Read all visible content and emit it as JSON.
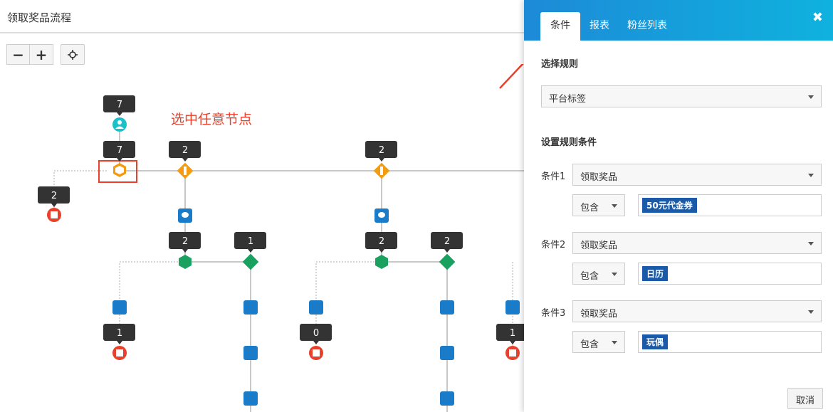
{
  "page": {
    "title": "领取奖品流程"
  },
  "zoom": {
    "out_label": "−",
    "in_label": "+",
    "center_icon": "crosshair-icon"
  },
  "annotation": {
    "text": "选中任意节点"
  },
  "flow": {
    "counts": {
      "top_user": "7",
      "selected": "7",
      "branch_a": "2",
      "branch_b": "2",
      "end_left": "2",
      "hex_a": "2",
      "diamond_a": "1",
      "hex_b": "2",
      "diamond_b": "2",
      "end_a": "1",
      "end_b": "0",
      "end_c": "1"
    }
  },
  "panel": {
    "tabs": [
      "条件",
      "报表",
      "粉丝列表"
    ],
    "active_tab": "条件",
    "close_icon": "close-icon",
    "rule_section_title": "选择规则",
    "rule_select": "平台标签",
    "cond_section_title": "设置规则条件",
    "conditions": [
      {
        "label": "条件1",
        "field": "领取奖品",
        "operator": "包含",
        "tag": "50元代金券"
      },
      {
        "label": "条件2",
        "field": "领取奖品",
        "operator": "包含",
        "tag": "日历"
      },
      {
        "label": "条件3",
        "field": "领取奖品",
        "operator": "包含",
        "tag": "玩偶"
      }
    ],
    "cancel_label": "取消"
  },
  "colors": {
    "accent": "#1d8ad8",
    "annotation_red": "#e8402a",
    "node_orange": "#f39c12",
    "node_green": "#1aa15f",
    "node_blue": "#1a7cc8",
    "node_red": "#e8402a",
    "node_teal": "#1bc1c8",
    "tag_blue": "#1a5aa8"
  }
}
